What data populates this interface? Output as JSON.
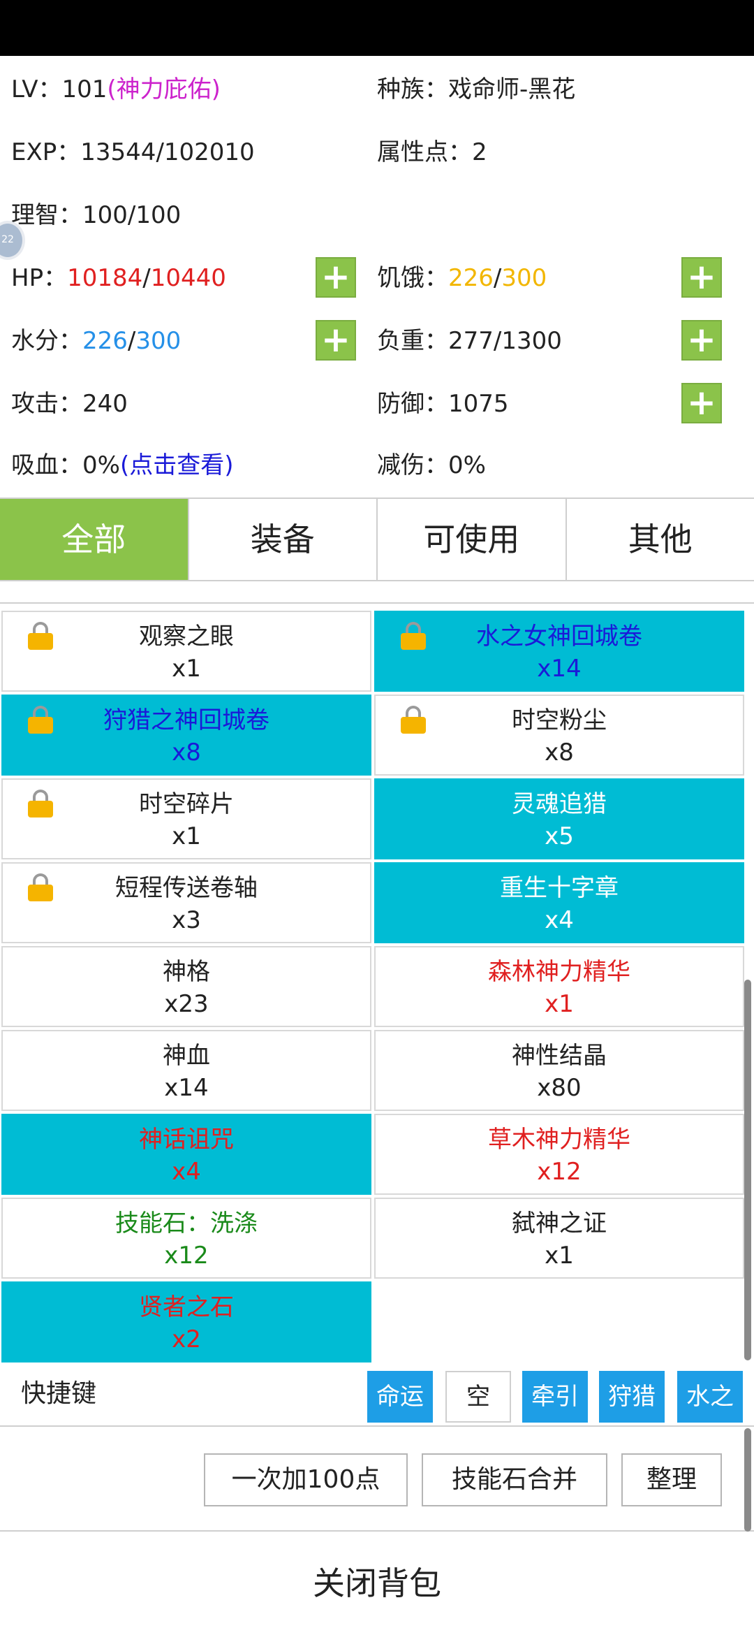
{
  "stats": {
    "lv_label": "LV：",
    "lv_value": "101",
    "lv_title": "(神力庇佑)",
    "race_label": "种族：",
    "race_value": "戏命师-黑花",
    "exp_label": "EXP：",
    "exp_value": "13544/102010",
    "attr_label": "属性点：",
    "attr_value": "2",
    "sanity_label": "理智：",
    "sanity_value": "100/100",
    "hp_label": "HP：",
    "hp_current": "10184",
    "hp_max": "10440",
    "hunger_label": "饥饿：",
    "hunger_current": "226",
    "hunger_max": "300",
    "water_label": "水分：",
    "water_current": "226",
    "water_max": "300",
    "load_label": "负重：",
    "load_value": "277/1300",
    "attack_label": "攻击：",
    "attack_value": "240",
    "defense_label": "防御：",
    "defense_value": "1075",
    "lifesteal_label": "吸血：",
    "lifesteal_value": "0%",
    "lifesteal_link": "(点击查看)",
    "reduction_label": "减伤：",
    "reduction_value": "0%",
    "slash": "/",
    "plus": "+"
  },
  "float_ball_text": "22",
  "tabs": [
    "全部",
    "装备",
    "可使用",
    "其他"
  ],
  "items": [
    {
      "name": "观察之眼",
      "qty": "x1",
      "color": "black",
      "bg": "white",
      "locked": true
    },
    {
      "name": "水之女神回城卷",
      "qty": "x14",
      "color": "blue",
      "bg": "cyan",
      "locked": true
    },
    {
      "name": "狩猎之神回城卷",
      "qty": "x8",
      "color": "blue",
      "bg": "cyan",
      "locked": true
    },
    {
      "name": "时空粉尘",
      "qty": "x8",
      "color": "black",
      "bg": "white",
      "locked": true
    },
    {
      "name": "时空碎片",
      "qty": "x1",
      "color": "black",
      "bg": "white",
      "locked": true
    },
    {
      "name": "灵魂追猎",
      "qty": "x5",
      "color": "white",
      "bg": "cyan",
      "locked": false
    },
    {
      "name": "短程传送卷轴",
      "qty": "x3",
      "color": "black",
      "bg": "white",
      "locked": true
    },
    {
      "name": "重生十字章",
      "qty": "x4",
      "color": "white",
      "bg": "cyan",
      "locked": false
    },
    {
      "name": "神格",
      "qty": "x23",
      "color": "black",
      "bg": "white",
      "locked": false
    },
    {
      "name": "森林神力精华",
      "qty": "x1",
      "color": "red",
      "bg": "white",
      "locked": false
    },
    {
      "name": "神血",
      "qty": "x14",
      "color": "black",
      "bg": "white",
      "locked": false
    },
    {
      "name": "神性结晶",
      "qty": "x80",
      "color": "black",
      "bg": "white",
      "locked": false
    },
    {
      "name": "神话诅咒",
      "qty": "x4",
      "color": "red",
      "bg": "cyan",
      "locked": false
    },
    {
      "name": "草木神力精华",
      "qty": "x12",
      "color": "red",
      "bg": "white",
      "locked": false
    },
    {
      "name": "技能石：洗涤",
      "qty": "x12",
      "color": "green",
      "bg": "white",
      "locked": false
    },
    {
      "name": "弑神之证",
      "qty": "x1",
      "color": "black",
      "bg": "white",
      "locked": false
    },
    {
      "name": "贤者之石",
      "qty": "x2",
      "color": "red",
      "bg": "cyan",
      "locked": false
    }
  ],
  "quickbar": {
    "label": "快捷键",
    "slots": [
      "命运",
      "空",
      "牵引",
      "狩猎",
      "水之"
    ]
  },
  "actions": {
    "add100": "一次加100点",
    "merge": "技能石合并",
    "sort": "整理"
  },
  "close_label": "关闭背包",
  "colors": {
    "accent_green": "#8bc34a",
    "cyan": "#00bcd4",
    "quick_blue": "#1e9ee6"
  }
}
